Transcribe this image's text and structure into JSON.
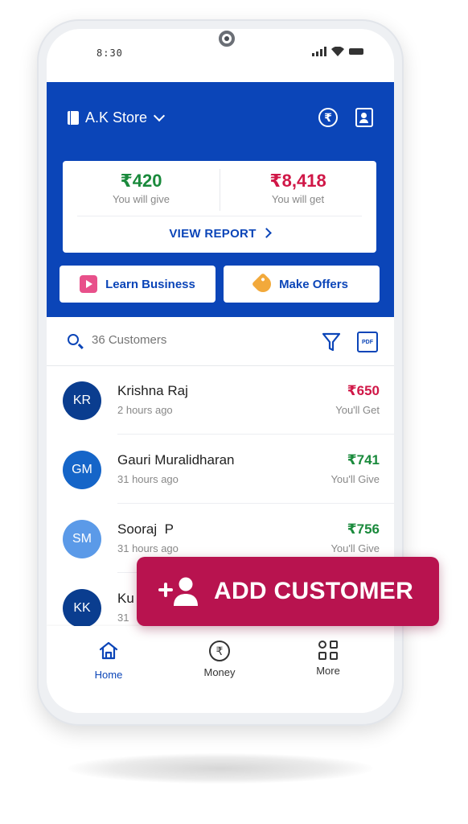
{
  "status": {
    "time": "8:30"
  },
  "header": {
    "store_name": "A.K Store",
    "icons": [
      "rupee-circle-icon",
      "calendar-contact-icon"
    ]
  },
  "summary": {
    "give_amount": "₹420",
    "give_label": "You will give",
    "get_amount": "₹8,418",
    "get_label": "You will get",
    "view_report": "VIEW REPORT"
  },
  "actions": {
    "learn": "Learn Business",
    "offers": "Make Offers"
  },
  "search": {
    "placeholder": "36 Customers",
    "pdf_label": "PDF"
  },
  "customers": [
    {
      "initials": "KR",
      "name": "Krishna Raj",
      "time": "2 hours ago",
      "amount": "₹650",
      "status": "You'll Get",
      "type": "get",
      "avatar_color": "#0a3d8f"
    },
    {
      "initials": "GM",
      "name": "Gauri Muralidharan",
      "time": "31 hours ago",
      "amount": "₹741",
      "status": "You'll Give",
      "type": "give",
      "avatar_color": "#1565c8"
    },
    {
      "initials": "SM",
      "name": "Sooraj  P",
      "time": "31 hours ago",
      "amount": "₹756",
      "status": "You'll Give",
      "type": "give",
      "avatar_color": "#5b9ae8"
    },
    {
      "initials": "KK",
      "name": "Ku",
      "time": "31",
      "amount": "",
      "status": "",
      "type": "give",
      "avatar_color": "#0a3d8f"
    }
  ],
  "nav": {
    "home": "Home",
    "money": "Money",
    "more": "More"
  },
  "fab": {
    "label": "ADD CUSTOMER"
  },
  "colors": {
    "primary": "#0b45b8",
    "give": "#1a8a3c",
    "get": "#d01747",
    "fab": "#b8134f"
  }
}
